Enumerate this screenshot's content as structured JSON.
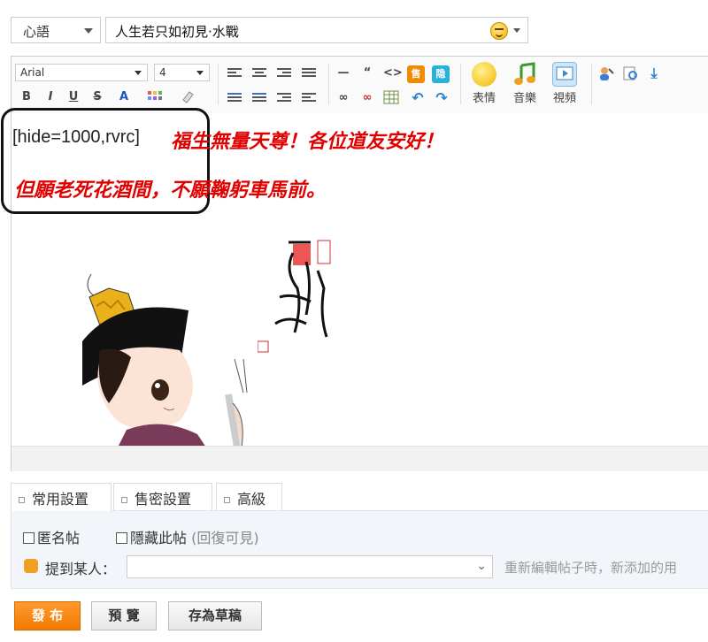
{
  "category": {
    "selected": "心語"
  },
  "title": {
    "value": "人生若只如初見·水戰"
  },
  "toolbar": {
    "font_family": "Arial",
    "font_size": "4",
    "labels": {
      "emoticon": "表情",
      "music": "音樂",
      "video": "視頻"
    },
    "small_buttons": [
      "B",
      "I",
      "U",
      "S",
      "A"
    ]
  },
  "content": {
    "hide_tag": "[hide=1000,rvrc]",
    "line1": "福生無量天尊！各位道友安好！",
    "line2": "但願老死花酒間，不願鞠躬車馬前。"
  },
  "tabs": [
    {
      "label": "常用設置",
      "active": true
    },
    {
      "label": "售密設置",
      "active": false
    },
    {
      "label": "高級",
      "active": false
    }
  ],
  "options": {
    "anonymous": "匿名帖",
    "hide_post": "隱藏此帖",
    "hide_post_hint": "(回復可見)",
    "mention_label": "提到某人：",
    "mention_hint": "重新編輯帖子時，新添加的用"
  },
  "buttons": {
    "publish": "發 布",
    "preview": "預 覽",
    "draft": "存為草稿"
  },
  "colors": {
    "red_text": "#e00000",
    "primary_orange": "#f27a00"
  }
}
